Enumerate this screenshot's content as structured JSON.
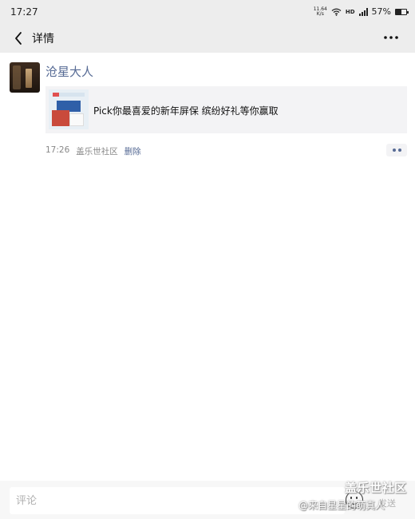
{
  "status_bar": {
    "time": "17:27",
    "net_speed_top": "11.64",
    "net_speed_bottom": "K/s",
    "hd_label": "HD",
    "battery_percent": "57%",
    "battery_level": 0.57
  },
  "header": {
    "title": "详情",
    "back_icon": "chevron-left-icon",
    "more_icon": "more-dots-icon"
  },
  "post": {
    "username": "沧星大人",
    "link_title": "Pick你最喜爱的新年屏保 缤纷好礼等你赢取",
    "time": "17:26",
    "source": "盖乐世社区",
    "delete_label": "删除"
  },
  "comment": {
    "placeholder": "评论",
    "send_label": "发送",
    "emoji_icon": "smiley-face-icon"
  },
  "watermark": {
    "line1": "盖乐世社区",
    "line2": "@来自星星的萌真人"
  },
  "colors": {
    "link_blue": "#576b95",
    "bar_gray": "#ededed",
    "card_gray": "#f3f3f5"
  }
}
